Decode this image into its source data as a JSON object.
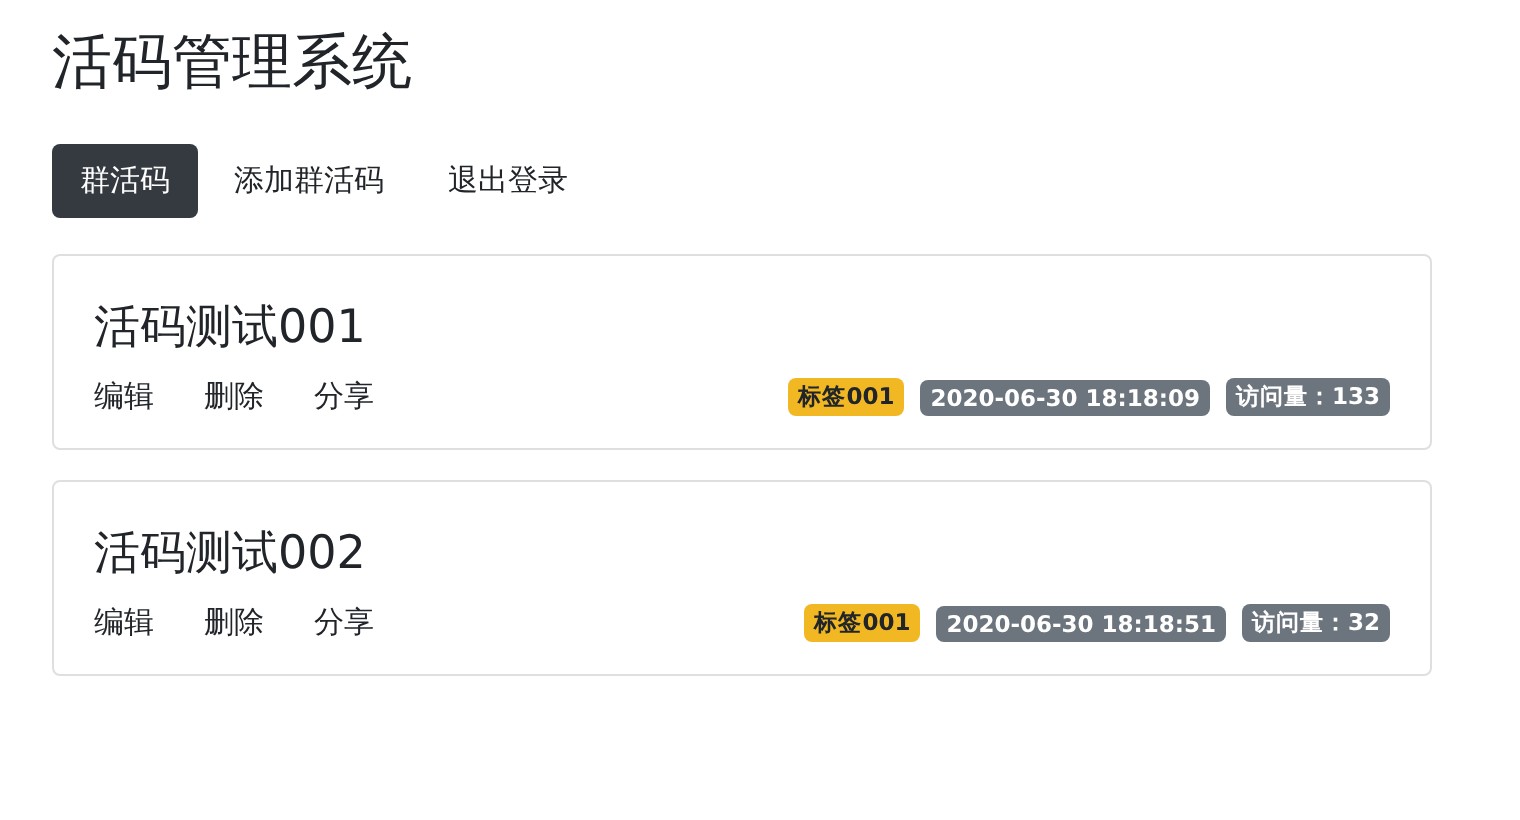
{
  "title": "活码管理系统",
  "tabs": [
    {
      "label": "群活码",
      "selected": true
    },
    {
      "label": "添加群活码",
      "selected": false
    },
    {
      "label": "退出登录",
      "selected": false
    }
  ],
  "cards": [
    {
      "name": "活码测试001",
      "actions": [
        "编辑",
        "删除",
        "分享"
      ],
      "tag": "标签001",
      "time": "2020-06-30 18:18:09",
      "visits": "访问量：133"
    },
    {
      "name": "活码测试002",
      "actions": [
        "编辑",
        "删除",
        "分享"
      ],
      "tag": "标签001",
      "time": "2020-06-30 18:18:51",
      "visits": "访问量：32"
    }
  ]
}
